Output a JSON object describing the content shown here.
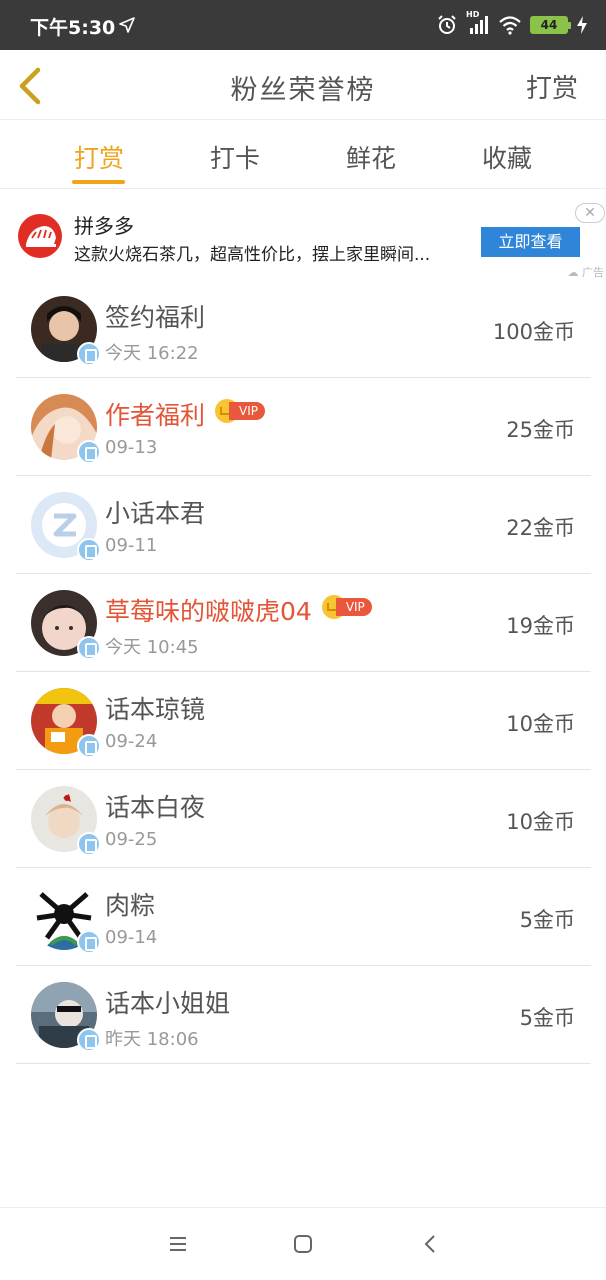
{
  "status_bar": {
    "time": "下午5:30",
    "battery": "44",
    "network": "HD"
  },
  "header": {
    "title": "粉丝荣誉榜",
    "action_label": "打赏"
  },
  "tabs": [
    {
      "label": "打赏",
      "active": true
    },
    {
      "label": "打卡",
      "active": false
    },
    {
      "label": "鲜花",
      "active": false
    },
    {
      "label": "收藏",
      "active": false
    }
  ],
  "ad": {
    "brand": "拼多多",
    "description": "这款火烧石茶几，超高性价比，摆上家里瞬间...",
    "button_label": "立即查看",
    "tag": "广告",
    "close": "✕"
  },
  "accent_color": "#f0a31b",
  "vip_color": "#e45436",
  "vip_label": "VIP",
  "rows": [
    {
      "name": "签约福利",
      "time": "今天 16:22",
      "amount": "100金币",
      "vip": false
    },
    {
      "name": "作者福利",
      "time": "09-13",
      "amount": "25金币",
      "vip": true
    },
    {
      "name": "小话本君",
      "time": "09-11",
      "amount": "22金币",
      "vip": false
    },
    {
      "name": "草莓味的啵啵虎04",
      "time": "今天 10:45",
      "amount": "19金币",
      "vip": true
    },
    {
      "name": "话本琼镜",
      "time": "09-24",
      "amount": "10金币",
      "vip": false
    },
    {
      "name": "话本白夜",
      "time": "09-25",
      "amount": "10金币",
      "vip": false
    },
    {
      "name": "肉粽",
      "time": "09-14",
      "amount": "5金币",
      "vip": false
    },
    {
      "name": "话本小姐姐",
      "time": "昨天 18:06",
      "amount": "5金币",
      "vip": false
    }
  ]
}
